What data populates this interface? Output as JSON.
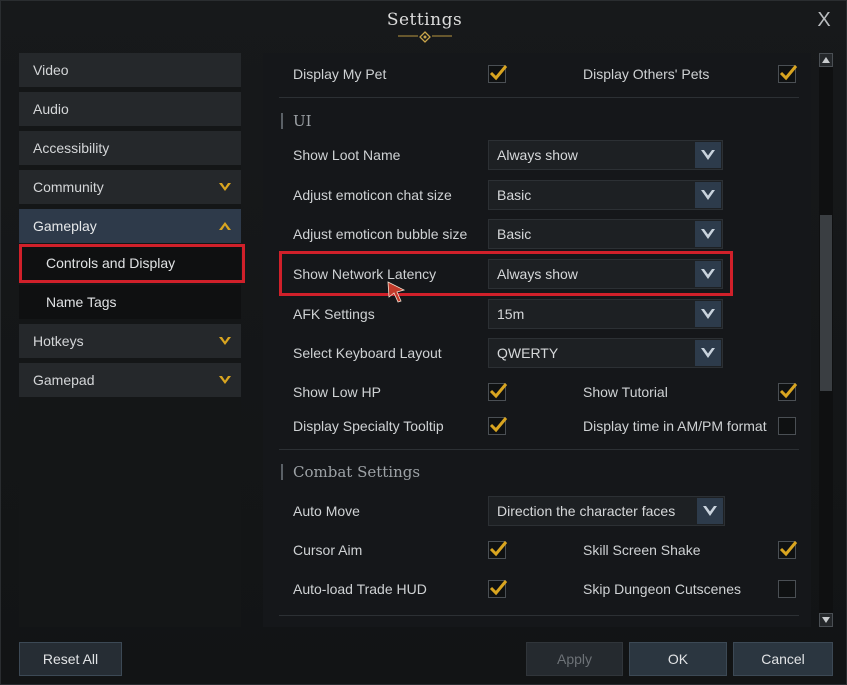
{
  "window": {
    "title": "Settings",
    "close_label": "X"
  },
  "sidebar": {
    "items": [
      {
        "label": "Video"
      },
      {
        "label": "Audio"
      },
      {
        "label": "Accessibility"
      },
      {
        "label": "Community",
        "expandable": true,
        "expanded": false
      },
      {
        "label": "Gameplay",
        "expandable": true,
        "expanded": true,
        "selected": true
      },
      {
        "label": "Controls and Display",
        "sub": true,
        "selected": true
      },
      {
        "label": "Name Tags",
        "sub": true
      },
      {
        "label": "Hotkeys",
        "expandable": true,
        "expanded": false
      },
      {
        "label": "Gamepad",
        "expandable": true,
        "expanded": false
      }
    ]
  },
  "top_rows": {
    "display_my_pet": {
      "label": "Display My Pet",
      "checked": true
    },
    "display_others_pets": {
      "label": "Display Others' Pets",
      "checked": true
    }
  },
  "ui_section": {
    "title": "UI",
    "show_loot_name": {
      "label": "Show Loot Name",
      "value": "Always show"
    },
    "emoticon_chat_size": {
      "label": "Adjust emoticon chat size",
      "value": "Basic"
    },
    "emoticon_bubble_size": {
      "label": "Adjust emoticon bubble size",
      "value": "Basic"
    },
    "show_network_latency": {
      "label": "Show Network Latency",
      "value": "Always show"
    },
    "afk_settings": {
      "label": "AFK Settings",
      "value": "15m"
    },
    "keyboard_layout": {
      "label": "Select Keyboard Layout",
      "value": "QWERTY"
    },
    "show_low_hp": {
      "label": "Show Low HP",
      "checked": true
    },
    "show_tutorial": {
      "label": "Show Tutorial",
      "checked": true
    },
    "specialty_tooltip": {
      "label": "Display Specialty Tooltip",
      "checked": true
    },
    "ampm_format": {
      "label": "Display time in AM/PM format",
      "checked": false
    }
  },
  "combat_section": {
    "title": "Combat Settings",
    "auto_move": {
      "label": "Auto Move",
      "value": "Direction the character faces"
    },
    "cursor_aim": {
      "label": "Cursor Aim",
      "checked": true
    },
    "skill_screen_shake": {
      "label": "Skill Screen Shake",
      "checked": true
    },
    "auto_load_trade_hud": {
      "label": "Auto-load Trade HUD",
      "checked": true
    },
    "skip_dungeon_cutscenes": {
      "label": "Skip Dungeon Cutscenes",
      "checked": false
    }
  },
  "buttons": {
    "reset_all": "Reset All",
    "apply": "Apply",
    "ok": "OK",
    "cancel": "Cancel"
  },
  "colors": {
    "accent_gold": "#d9a520",
    "highlight_red": "#d0202a",
    "selected_blue": "#2e3a4a"
  }
}
